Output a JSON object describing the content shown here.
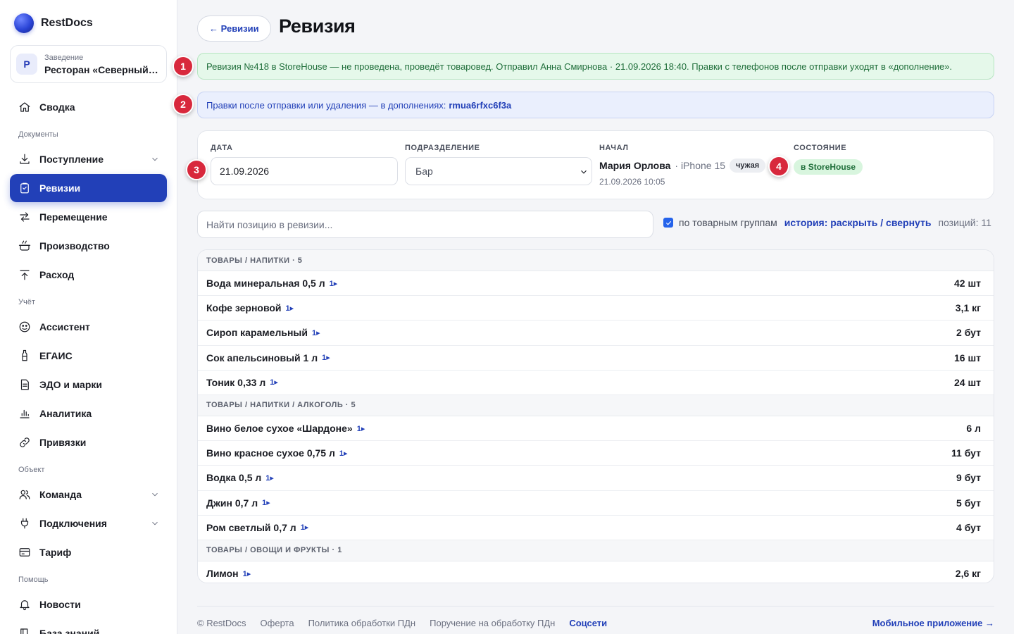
{
  "brand": {
    "name": "RestDocs"
  },
  "venue": {
    "avatar_letter": "Р",
    "label": "Заведение",
    "name": "Ресторан «Северный берег»"
  },
  "nav": {
    "summary": "Сводка",
    "section_docs": "Документы",
    "incoming": "Поступление",
    "revisions": "Ревизии",
    "transfer": "Перемещение",
    "production": "Производство",
    "expense": "Расход",
    "section_accounting": "Учёт",
    "assistant": "Ассистент",
    "egais": "ЕГАИС",
    "edo": "ЭДО и марки",
    "analytics": "Аналитика",
    "bindings": "Привязки",
    "section_object": "Объект",
    "team": "Команда",
    "connections": "Подключения",
    "tariff": "Тариф",
    "section_help": "Помощь",
    "news": "Новости",
    "kb": "База знаний"
  },
  "header": {
    "back_label": "← Ревизии",
    "title": "Ревизия"
  },
  "markers": [
    "1",
    "2",
    "3",
    "4"
  ],
  "banners": {
    "status": "Ревизия №418 в StoreHouse — не проведена, проведёт товаровед. Отправил Анна Смирнова · 21.09.2026 18:40. Правки с телефонов после отправки уходят в «дополнение».",
    "addendum_text": "Правки после отправки или удаления — в дополнениях:",
    "addendum_code": "rmua6rfxc6f3a"
  },
  "info": {
    "date_label": "ДАТА",
    "date_value": "21.09.2026",
    "dept_label": "ПОДРАЗДЕЛЕНИЕ",
    "dept_value": "Бар",
    "started_label": "НАЧАЛ",
    "started_name": "Мария Орлова",
    "started_device": "· iPhone 15",
    "started_badge": "чужая",
    "started_time": "21.09.2026 10:05",
    "state_label": "СОСТОЯНИЕ",
    "state_value": "в StoreHouse"
  },
  "toolbar": {
    "search_placeholder": "Найти позицию в ревизии...",
    "group_checkbox_label": "по товарным группам",
    "history_toggle": "история: раскрыть / свернуть",
    "positions_count": "позиций: 11",
    "checkbox_checked": true
  },
  "groups": [
    {
      "title": "ТОВАРЫ / НАПИТКИ · 5",
      "items": [
        {
          "name": "Вода минеральная 0,5 л",
          "rev": "1▸",
          "qty": "42 шт"
        },
        {
          "name": "Кофе зерновой",
          "rev": "1▸",
          "qty": "3,1 кг"
        },
        {
          "name": "Сироп карамельный",
          "rev": "1▸",
          "qty": "2 бут"
        },
        {
          "name": "Сок апельсиновый 1 л",
          "rev": "1▸",
          "qty": "16 шт"
        },
        {
          "name": "Тоник 0,33 л",
          "rev": "1▸",
          "qty": "24 шт"
        }
      ]
    },
    {
      "title": "ТОВАРЫ / НАПИТКИ / АЛКОГОЛЬ · 5",
      "items": [
        {
          "name": "Вино белое сухое «Шардоне»",
          "rev": "1▸",
          "qty": "6 л"
        },
        {
          "name": "Вино красное сухое 0,75 л",
          "rev": "1▸",
          "qty": "11 бут"
        },
        {
          "name": "Водка 0,5 л",
          "rev": "1▸",
          "qty": "9 бут"
        },
        {
          "name": "Джин 0,7 л",
          "rev": "1▸",
          "qty": "5 бут"
        },
        {
          "name": "Ром светлый 0,7 л",
          "rev": "1▸",
          "qty": "4 бут"
        }
      ]
    },
    {
      "title": "ТОВАРЫ / ОВОЩИ И ФРУКТЫ · 1",
      "items": [
        {
          "name": "Лимон",
          "rev": "1▸",
          "qty": "2,6 кг"
        }
      ]
    }
  ],
  "footer": {
    "copyright": "© RestDocs",
    "offer": "Оферта",
    "privacy": "Политика обработки ПДн",
    "consent": "Поручение на обработку ПДн",
    "social": "Соцсети",
    "mobile": "Мобильное приложение →"
  },
  "colors": {
    "accent": "#2240b8",
    "marker": "#d8283c",
    "success_bg": "#e5f8ea",
    "info_bg": "#eaeffd"
  }
}
